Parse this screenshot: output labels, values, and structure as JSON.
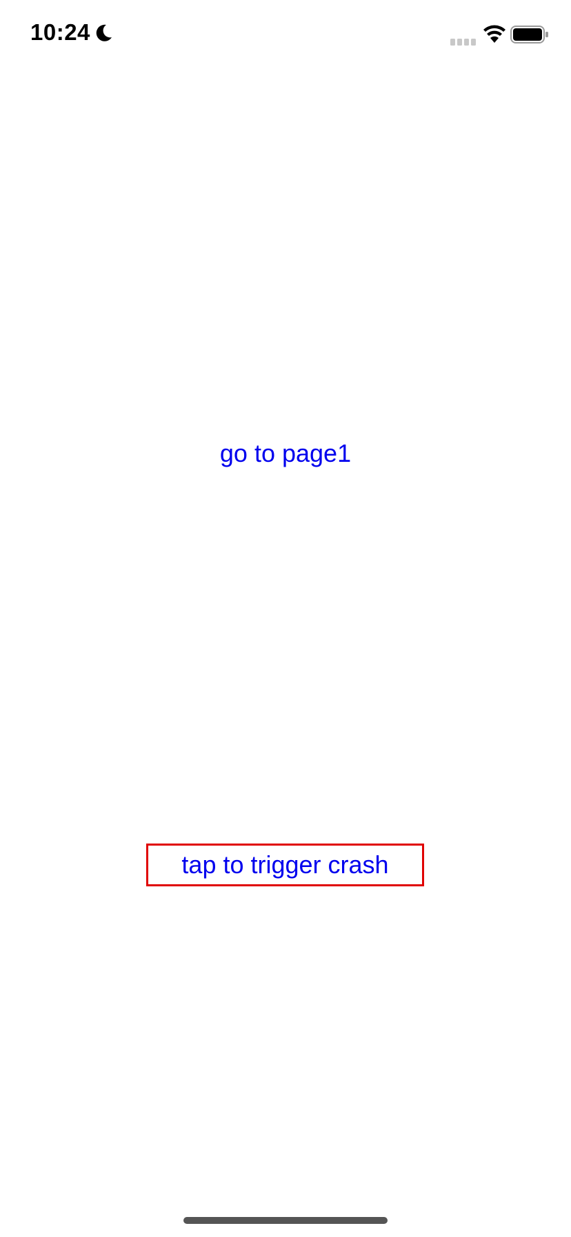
{
  "status_bar": {
    "time": "10:24",
    "icons": [
      "moon-icon",
      "cellular-signal-icon",
      "wifi-icon",
      "battery-icon"
    ]
  },
  "main": {
    "nav_link_label": "go to page1",
    "crash_button_label": "tap to trigger crash"
  },
  "colors": {
    "link": "#0000ee",
    "crash_border": "#e00000",
    "background": "#ffffff"
  }
}
